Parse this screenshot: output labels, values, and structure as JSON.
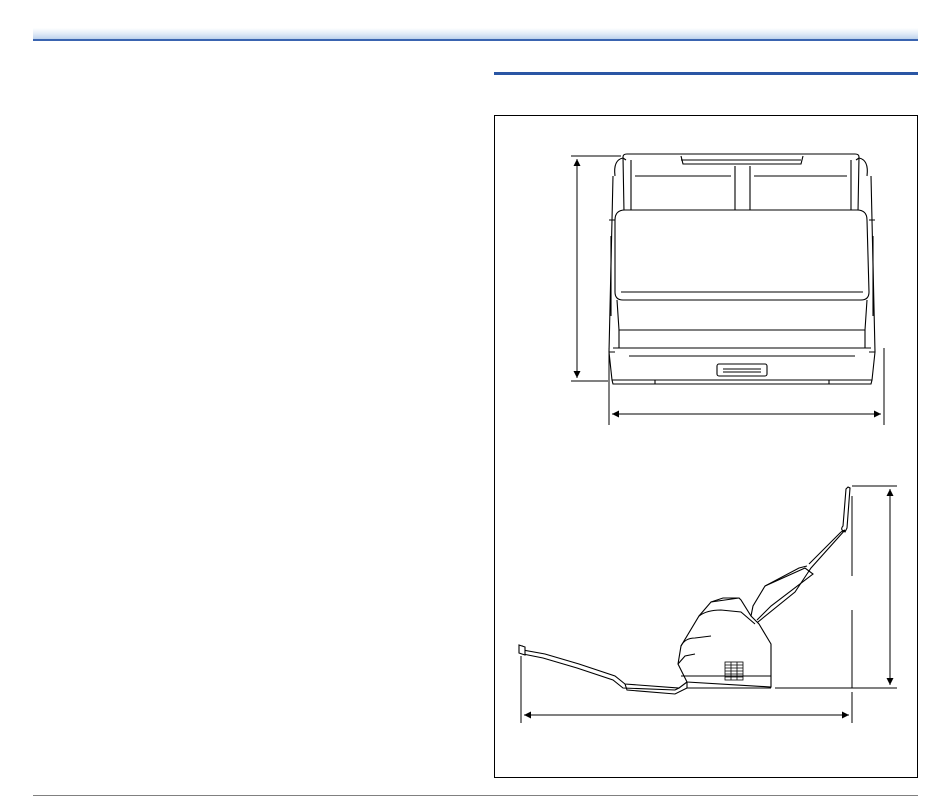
{
  "page": {
    "header_band_color": "#a9c3e6",
    "header_rule_color": "#3a64b0",
    "section_rule_color": "#2a56a4",
    "footer_rule_color": "#808080"
  },
  "figure": {
    "front_view": {
      "illustration": "scanner-front-view",
      "dimensions": [
        "height-arrow",
        "width-arrow"
      ]
    },
    "side_view": {
      "illustration": "scanner-side-view",
      "dimensions": [
        "height-arrow",
        "depth-arrow"
      ]
    }
  }
}
